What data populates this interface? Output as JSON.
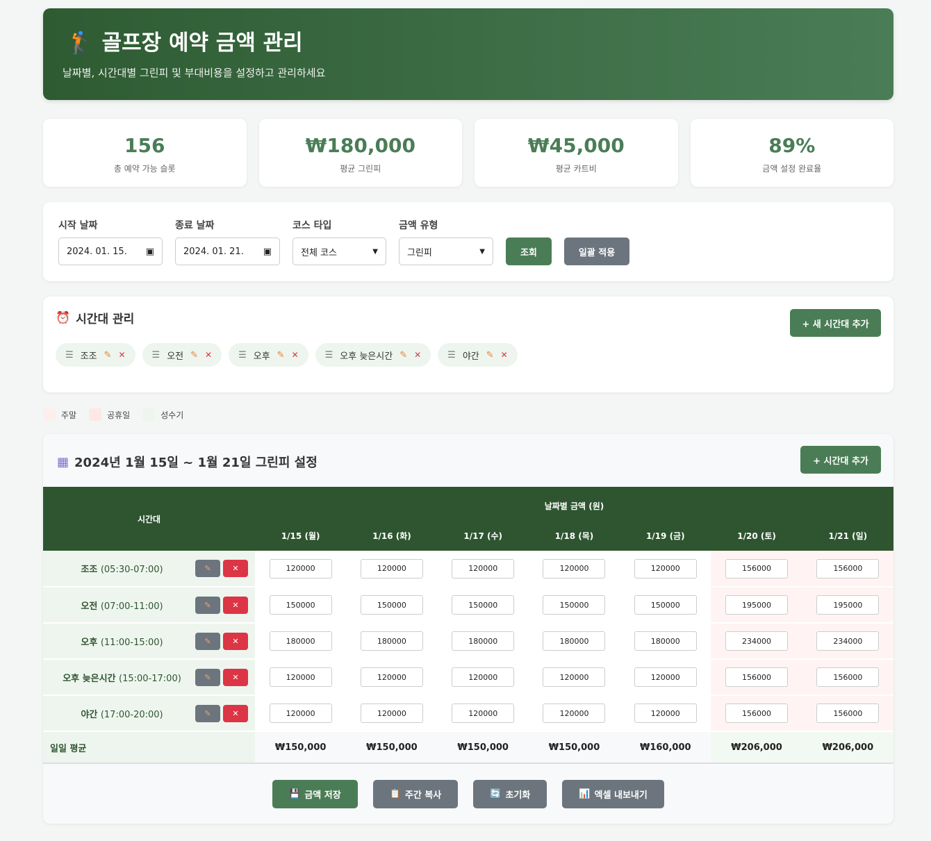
{
  "header": {
    "icon": "golfer-icon",
    "title": "골프장 예약 금액 관리",
    "subtitle": "날짜별, 시간대별 그린피 및 부대비용을 설정하고 관리하세요"
  },
  "stats": [
    {
      "value": "156",
      "label": "총 예약 가능 슬롯"
    },
    {
      "value": "₩180,000",
      "label": "평균 그린피"
    },
    {
      "value": "₩45,000",
      "label": "평균 카트비"
    },
    {
      "value": "89%",
      "label": "금액 설정 완료율"
    }
  ],
  "filters": {
    "start_label": "시작 날짜",
    "start_value": "2024. 01. 15.",
    "end_label": "종료 날짜",
    "end_value": "2024. 01. 21.",
    "course_label": "코스 타입",
    "course_value": "전체 코스",
    "price_label": "금액 유형",
    "price_value": "그린피",
    "search_button": "조회",
    "apply_button": "일괄 적용"
  },
  "slots_panel": {
    "title": "시간대 관리",
    "add_button": "+ 새 시간대 추가",
    "chips": [
      "조조",
      "오전",
      "오후",
      "오후 늦은시간",
      "야간"
    ]
  },
  "legend": [
    {
      "label": "주말",
      "color": "#fdeeee"
    },
    {
      "label": "공휴일",
      "color": "#fde8e4"
    },
    {
      "label": "성수기",
      "color": "#edf5ee"
    }
  ],
  "table": {
    "title": "2024년 1월 15일 ~ 1월 21일 그린피 설정",
    "add_button": "+ 시간대 추가",
    "slot_header": "시간대",
    "group_header": "날짜별 금액 (원)",
    "days": [
      "1/15 (월)",
      "1/16 (화)",
      "1/17 (수)",
      "1/18 (목)",
      "1/19 (금)",
      "1/20 (토)",
      "1/21 (일)"
    ],
    "rows": [
      {
        "name": "조조",
        "time": "(05:30-07:00)",
        "prices": [
          "120000",
          "120000",
          "120000",
          "120000",
          "120000",
          "156000",
          "156000"
        ]
      },
      {
        "name": "오전",
        "time": "(07:00-11:00)",
        "prices": [
          "150000",
          "150000",
          "150000",
          "150000",
          "150000",
          "195000",
          "195000"
        ]
      },
      {
        "name": "오후",
        "time": "(11:00-15:00)",
        "prices": [
          "180000",
          "180000",
          "180000",
          "180000",
          "180000",
          "234000",
          "234000"
        ]
      },
      {
        "name": "오후 늦은시간",
        "time": "(15:00-17:00)",
        "prices": [
          "120000",
          "120000",
          "120000",
          "120000",
          "120000",
          "156000",
          "156000"
        ]
      },
      {
        "name": "야간",
        "time": "(17:00-20:00)",
        "prices": [
          "120000",
          "120000",
          "120000",
          "120000",
          "120000",
          "156000",
          "156000"
        ]
      }
    ],
    "avg_label": "일일 평균",
    "averages": [
      "₩150,000",
      "₩150,000",
      "₩150,000",
      "₩150,000",
      "₩160,000",
      "₩206,000",
      "₩206,000"
    ]
  },
  "actions": {
    "save": "금액 저장",
    "copy": "주간 복사",
    "reset": "초기화",
    "export": "엑셀 내보내기"
  }
}
